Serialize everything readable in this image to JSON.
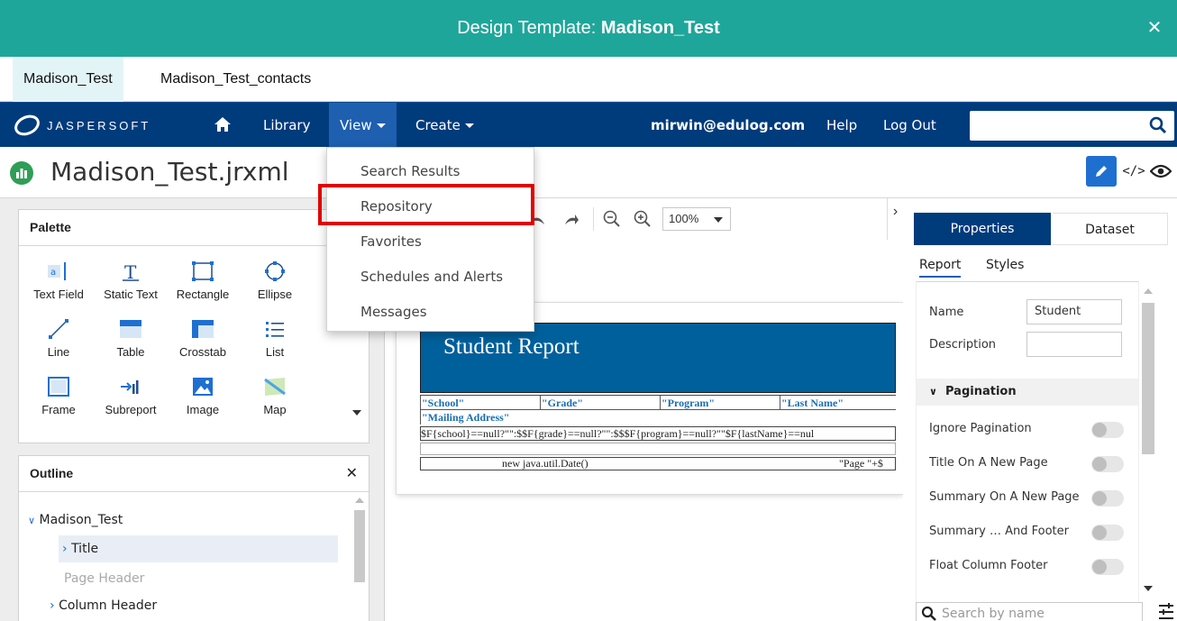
{
  "dialog": {
    "title_prefix": "Design Template: ",
    "title_name": "Madison_Test",
    "close_label": "✕"
  },
  "doc_tabs": [
    {
      "label": "Madison_Test",
      "active": true
    },
    {
      "label": "Madison_Test_contacts",
      "active": false
    }
  ],
  "navbar": {
    "logo_text": "JASPERSOFT",
    "home_icon": "home-icon",
    "items": {
      "library": "Library",
      "view": "View",
      "create": "Create",
      "user": "mirwin@edulog.com",
      "help": "Help",
      "logout": "Log Out"
    },
    "search_value": ""
  },
  "view_menu": {
    "items": [
      "Search Results",
      "Repository",
      "Favorites",
      "Schedules and Alerts",
      "Messages"
    ],
    "highlighted": "Repository"
  },
  "header": {
    "file_title": "Madison_Test.jrxml"
  },
  "palette": {
    "title": "Palette",
    "items": [
      [
        "Text Field",
        "Static Text",
        "Rectangle",
        "Ellipse"
      ],
      [
        "Line",
        "Table",
        "Crosstab",
        "List"
      ],
      [
        "Frame",
        "Subreport",
        "Image",
        "Map"
      ]
    ]
  },
  "outline": {
    "title": "Outline",
    "tree": {
      "root": "Madison_Test",
      "title": "Title",
      "page_header": "Page Header",
      "column_header": "Column Header"
    }
  },
  "canvas": {
    "zoom": "100%",
    "report_title": "Student Report",
    "headers": [
      "\"School\"",
      "\"Grade\"",
      "\"Program\"",
      "\"Last Name\""
    ],
    "mailing_header": "\"Mailing Address\"",
    "detail_text": "$F{school}==null?\"\":$$F{grade}==null?\"\":$$$F{program}==null?\"\"$F{lastName}==nul",
    "footer_left": "new java.util.Date()",
    "footer_right": "\"Page \"+$"
  },
  "properties": {
    "tabs": [
      "Properties",
      "Dataset"
    ],
    "subtabs": [
      "Report",
      "Styles"
    ],
    "name_label": "Name",
    "name_value": "Student",
    "description_label": "Description",
    "description_value": "",
    "section": "Pagination",
    "toggles": [
      {
        "label": "Ignore Pagination",
        "on": false
      },
      {
        "label": "Title On A New Page",
        "on": false
      },
      {
        "label": "Summary On A New Page",
        "on": false
      },
      {
        "label": "Summary … And Footer",
        "on": false
      },
      {
        "label": "Float Column Footer",
        "on": false
      }
    ],
    "search_placeholder": "Search by name"
  },
  "colors": {
    "titlebar": "#1fa69a",
    "navbar": "#003b7c",
    "nav_active": "#1e5fb0",
    "report_band": "#00609c",
    "highlight": "#e00000"
  }
}
